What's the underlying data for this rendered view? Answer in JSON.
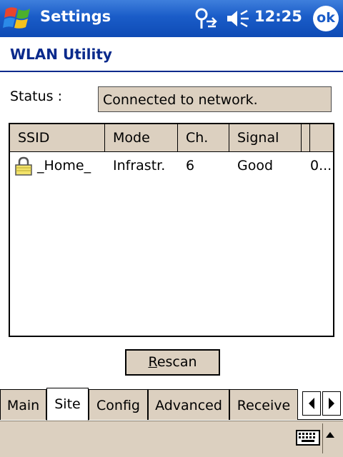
{
  "titlebar": {
    "title": "Settings",
    "time": "12:25",
    "ok_label": "ok",
    "icons": [
      "windows-start-icon",
      "connectivity-icon",
      "volume-icon"
    ]
  },
  "app": {
    "header": "WLAN Utility"
  },
  "status": {
    "label": "Status :",
    "value": "Connected to network."
  },
  "list": {
    "columns": [
      "SSID",
      "Mode",
      "Ch.",
      "Signal",
      ""
    ],
    "rows": [
      {
        "icon": "lock-icon",
        "ssid": "_Home_",
        "mode": "Infrastr.",
        "channel": "6",
        "signal": "Good",
        "extra": "0..."
      }
    ]
  },
  "rescan": {
    "underline": "R",
    "rest": "escan"
  },
  "tabs": {
    "items": [
      "Main",
      "Site",
      "Config",
      "Advanced",
      "Receive"
    ],
    "active": "Site"
  },
  "colors": {
    "titlebar": "#1a5cc8",
    "header_text": "#0a2a8c",
    "control_bg": "#dcd0c0"
  }
}
